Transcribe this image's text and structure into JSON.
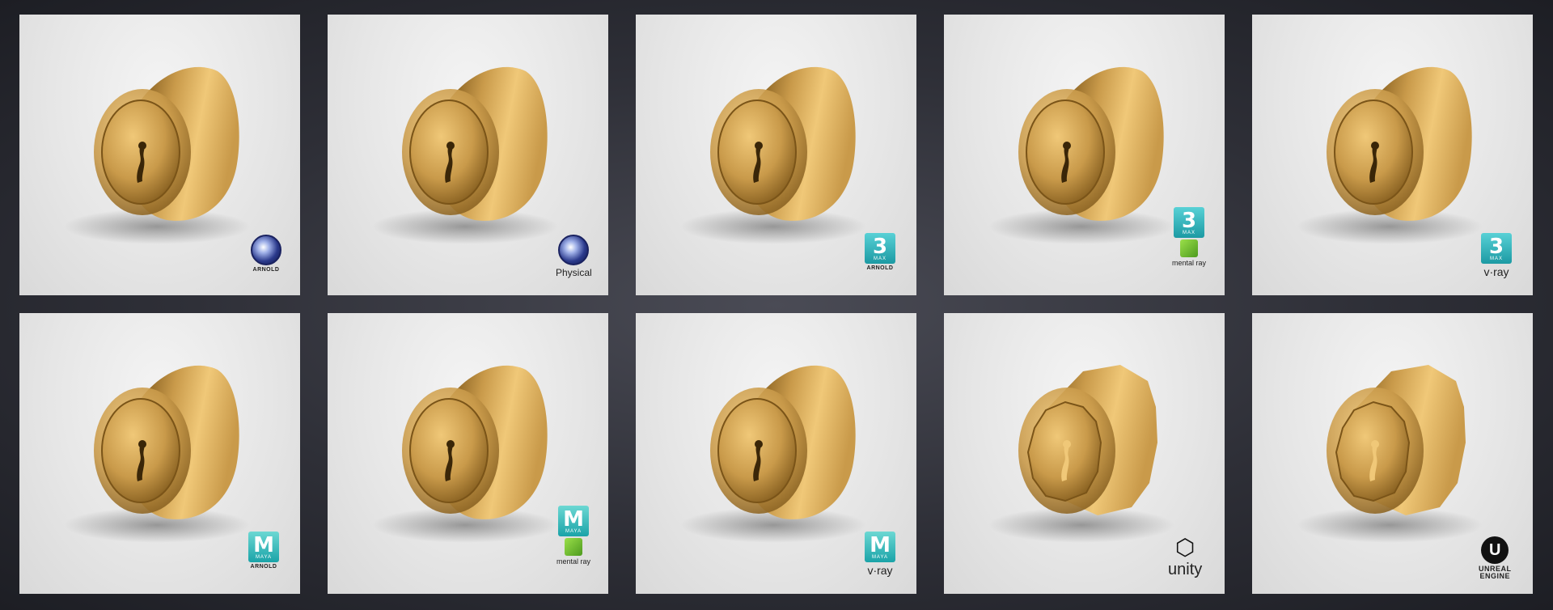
{
  "tiles": [
    {
      "id": "c4d-arnold",
      "renderer_labels": [
        "ARNOLD"
      ]
    },
    {
      "id": "c4d-physical",
      "renderer_labels": [
        "Physical"
      ]
    },
    {
      "id": "max-arnold",
      "app_label": "3",
      "app_sub": "MAX",
      "renderer_labels": [
        "ARNOLD"
      ]
    },
    {
      "id": "max-mentalray",
      "app_label": "3",
      "app_sub": "MAX",
      "renderer_labels": [
        "mental ray"
      ]
    },
    {
      "id": "max-vray",
      "app_label": "3",
      "app_sub": "MAX",
      "renderer_labels": [
        "v·ray"
      ]
    },
    {
      "id": "maya-arnold",
      "app_label": "M",
      "app_sub": "MAYA",
      "renderer_labels": [
        "ARNOLD"
      ]
    },
    {
      "id": "maya-mentalray",
      "app_label": "M",
      "app_sub": "MAYA",
      "renderer_labels": [
        "mental ray"
      ]
    },
    {
      "id": "maya-vray",
      "app_label": "M",
      "app_sub": "MAYA",
      "renderer_labels": [
        "v·ray"
      ]
    },
    {
      "id": "unity",
      "renderer_labels": [
        "unity"
      ]
    },
    {
      "id": "unreal",
      "renderer_labels": [
        "UNREAL",
        "ENGINE"
      ]
    }
  ],
  "icons": {
    "cinema4d": "cinema4d-logo-icon",
    "arnold": "arnold-logo-icon",
    "max": "3dsmax-logo-icon",
    "maya": "maya-logo-icon",
    "mentalray": "mentalray-logo-icon",
    "vray": "vray-logo-icon",
    "unity": "unity-logo-icon",
    "unreal": "unreal-logo-icon"
  },
  "colors": {
    "brass_light": "#f0c878",
    "brass_mid": "#c99a4a",
    "brass_dark": "#7a5418",
    "backdrop": "#e6e6e6",
    "page_bg": "#2e2f37",
    "max_teal": "#1c9aa3",
    "maya_teal": "#1aa3a8"
  }
}
